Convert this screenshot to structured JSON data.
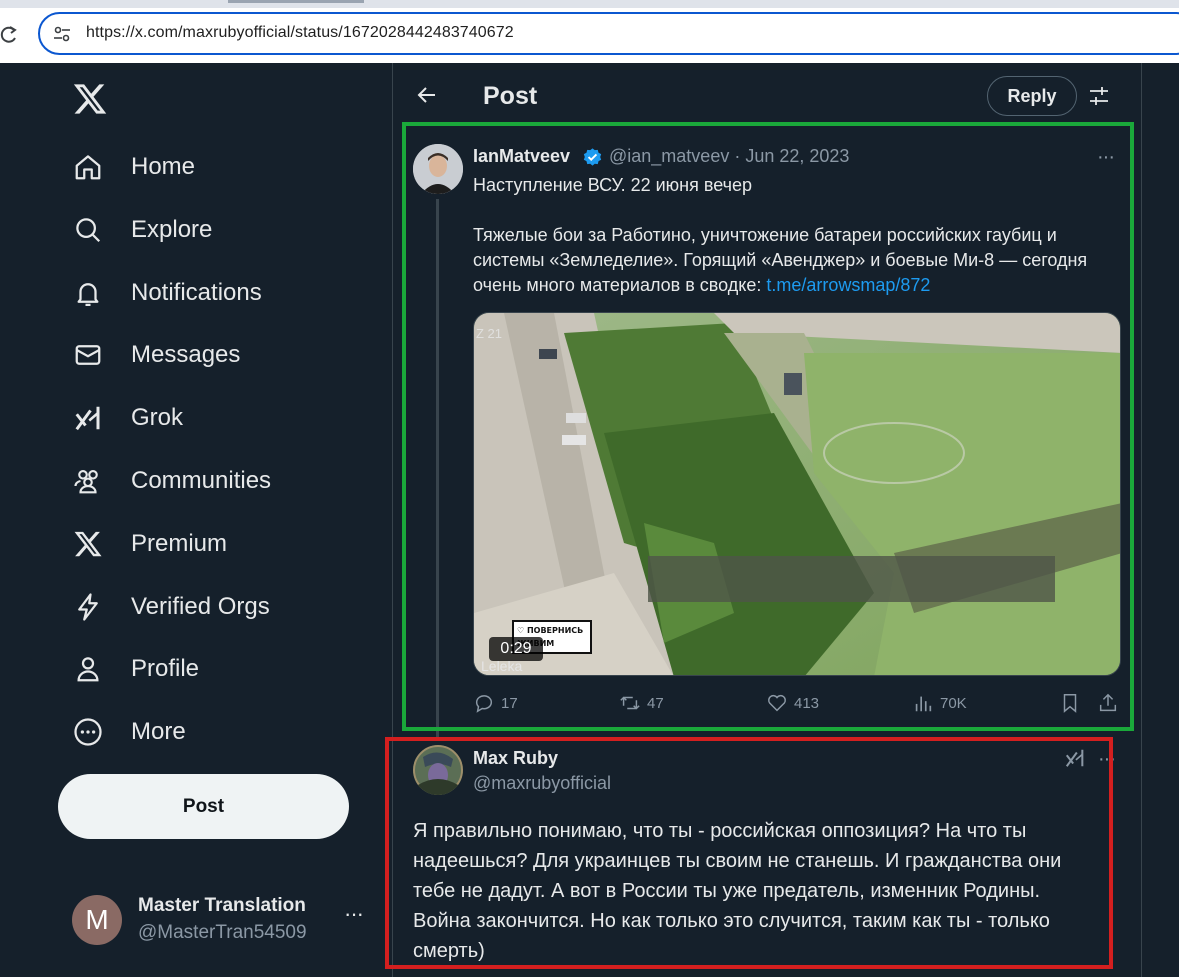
{
  "browser": {
    "url": "https://x.com/maxrubyofficial/status/1672028442483740672"
  },
  "nav": {
    "items": [
      {
        "label": "Home",
        "icon": "home-icon"
      },
      {
        "label": "Explore",
        "icon": "search-icon"
      },
      {
        "label": "Notifications",
        "icon": "bell-icon"
      },
      {
        "label": "Messages",
        "icon": "envelope-icon"
      },
      {
        "label": "Grok",
        "icon": "grok-icon"
      },
      {
        "label": "Communities",
        "icon": "communities-icon"
      },
      {
        "label": "Premium",
        "icon": "x-logo-icon"
      },
      {
        "label": "Verified Orgs",
        "icon": "lightning-icon"
      },
      {
        "label": "Profile",
        "icon": "person-icon"
      },
      {
        "label": "More",
        "icon": "more-circle-icon"
      }
    ],
    "post_button": "Post"
  },
  "account": {
    "avatar_letter": "M",
    "name": "Master Translation",
    "handle": "@MasterTran54509",
    "more": "···"
  },
  "header": {
    "title": "Post",
    "reply_button": "Reply"
  },
  "tweet1": {
    "name": "IanMatveev",
    "meta": "@ian_matveev · Jun 22, 2023",
    "line1": "Наступление ВСУ. 22 июня вечер",
    "body": "Тяжелые бои за Работино, уничтожение батареи российских гаубиц и системы «Земледелие». Горящий «Авенджер» и боевые Ми-8 — сегодня очень много материалов в сводке: ",
    "link": "t.me/arrowsmap/872",
    "video": {
      "duration": "0:29",
      "watermark": "Leleka",
      "corner_label": "Z 21",
      "sticker_line1": "♡ ПОВЕРНИСЬ",
      "sticker_line2": "ЖИВИМ"
    },
    "stats": {
      "replies": "17",
      "reposts": "47",
      "likes": "413",
      "views": "70K"
    }
  },
  "tweet2": {
    "name": "Max Ruby",
    "handle": "@maxrubyofficial",
    "text": "Я правильно понимаю, что ты - российская оппозиция? На что ты надеешься? Для украинцев ты своим не станешь. И гражданства они тебе не дадут. А вот в России ты уже предатель, изменник Родины. Война закончится. Но как только это случится, таким как ты - только смерть)"
  },
  "colors": {
    "background": "#15202b",
    "accent": "#1d9bf0",
    "annotation_green": "#1aa83a",
    "annotation_red": "#d41f1f"
  }
}
